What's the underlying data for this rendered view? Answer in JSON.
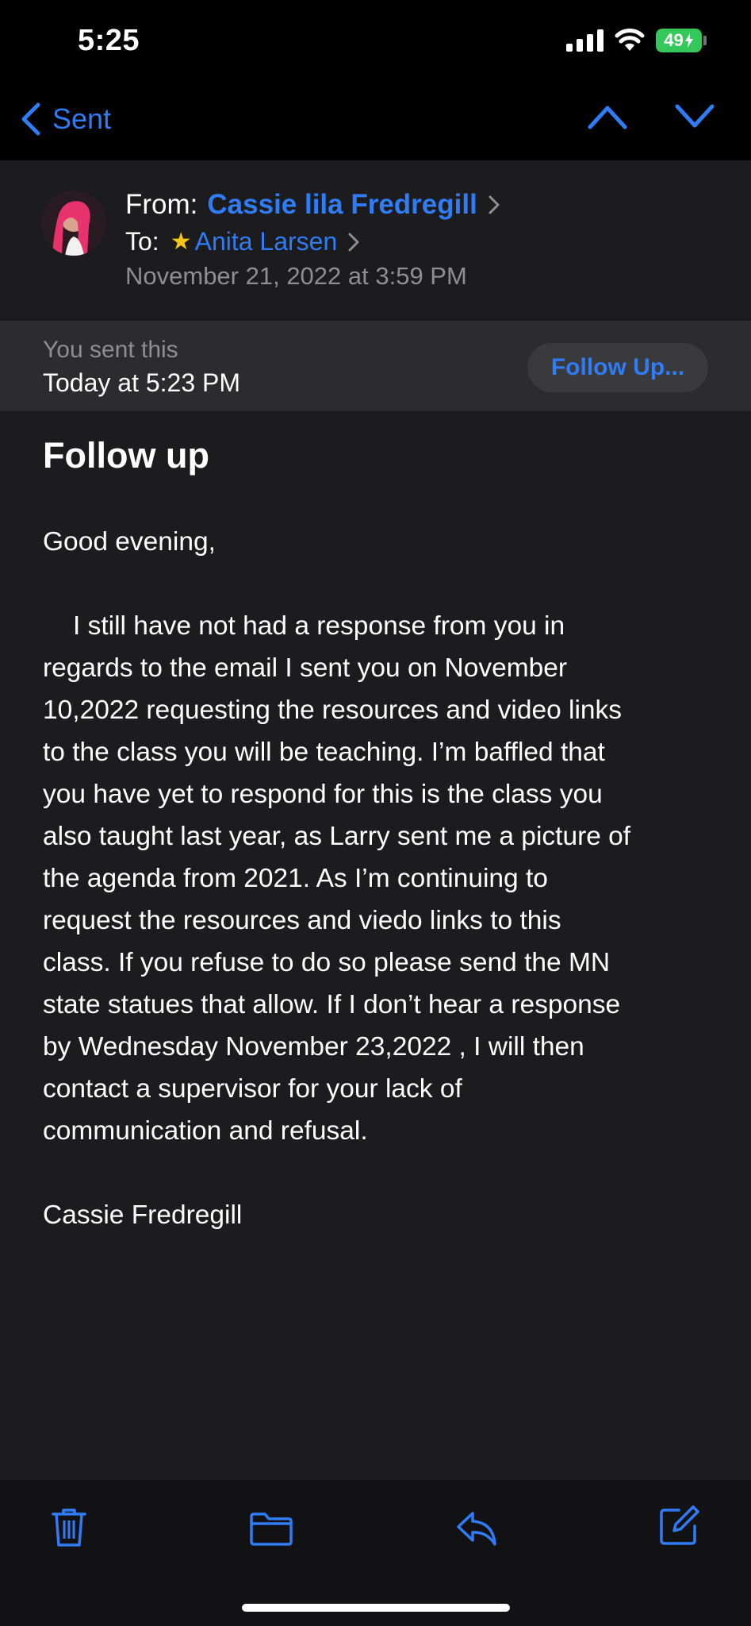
{
  "status": {
    "time": "5:25",
    "battery": "49"
  },
  "nav": {
    "back_label": "Sent",
    "icons": [
      "chevron-left-icon",
      "chevron-up-icon",
      "chevron-down-icon"
    ]
  },
  "header": {
    "from_label": "From:",
    "from_name": "Cassie lila Fredregill",
    "to_label": "To:",
    "to_name": "Anita Larsen",
    "date": "November 21, 2022 at 3:59 PM"
  },
  "sent_banner": {
    "label": "You sent this",
    "time": "Today at 5:23 PM",
    "follow_button": "Follow Up..."
  },
  "email": {
    "subject": "Follow up",
    "greeting": "Good evening,",
    "lines": [
      "I still have not had a response from you in",
      "regards to the email I sent you on November",
      "10,2022 requesting the resources and video links",
      "to the class you will be teaching. I’m baffled that",
      "you have yet to respond for this is the class you",
      "also taught last year, as Larry sent me a picture of",
      "the agenda from 2021. As I’m continuing to",
      "request the resources and viedo links to this",
      "class. If you refuse to do so please send the MN",
      "state statues that allow. If I don’t hear a response",
      "by Wednesday November 23,2022 , I will then",
      "contact a supervisor for your lack of",
      "communication and refusal."
    ],
    "signature": "Cassie Fredregill"
  },
  "toolbar": {
    "icons": [
      "trash-icon",
      "folder-icon",
      "reply-icon",
      "compose-icon"
    ]
  },
  "colors": {
    "accent": "#2f7cf6",
    "background": "#1c1c1e",
    "banner": "#2c2c2e",
    "battery": "#34c759",
    "star": "#f5c518"
  }
}
